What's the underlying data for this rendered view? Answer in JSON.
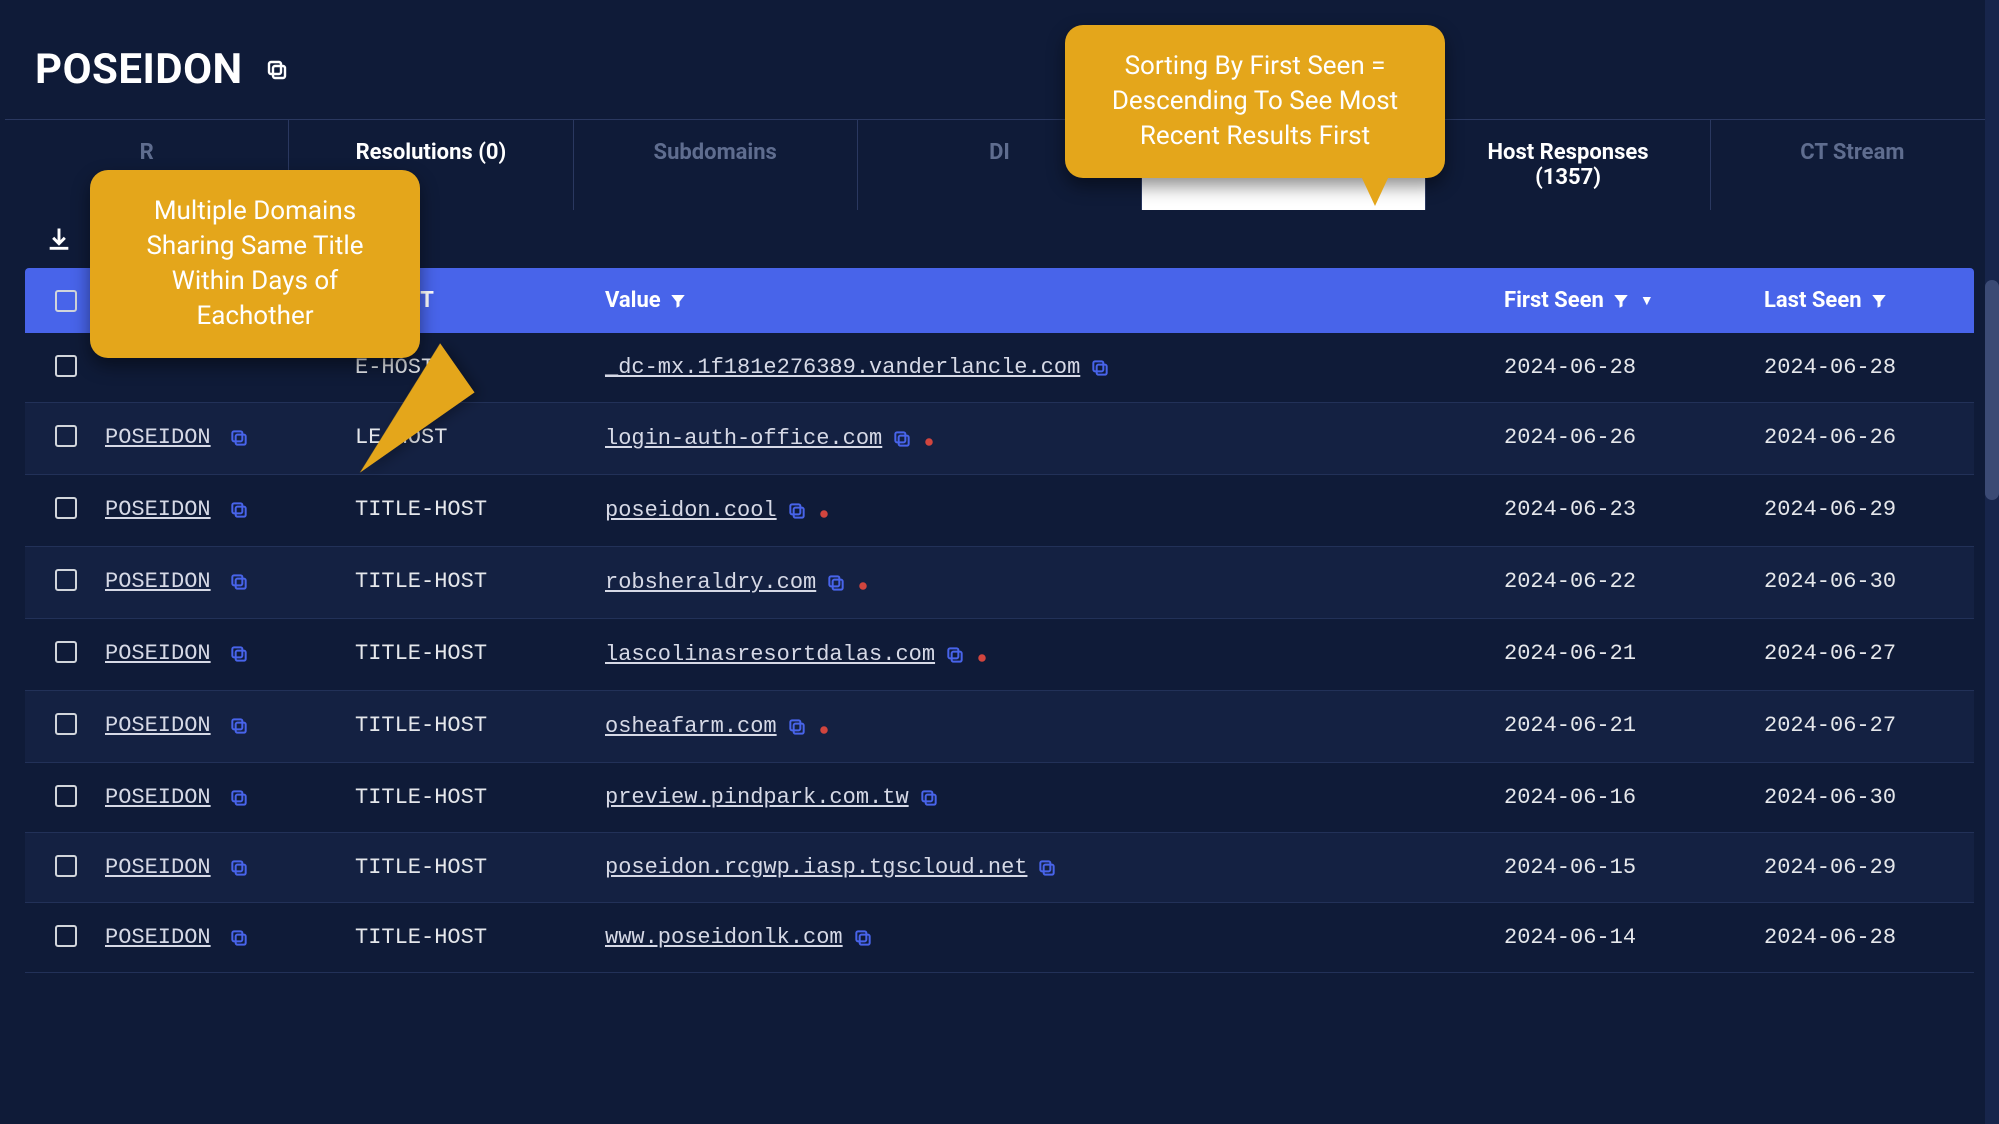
{
  "page_title": "POSEIDON",
  "tabs": [
    {
      "label": "R",
      "state": "normal"
    },
    {
      "label": "Resolutions (0)",
      "state": "highlight"
    },
    {
      "label": "Subdomains",
      "state": "normal"
    },
    {
      "label": "DI",
      "state": "normal"
    },
    {
      "label": "",
      "state": "active"
    },
    {
      "label": "Host Responses (1357)",
      "state": "highlight"
    },
    {
      "label": "CT Stream",
      "state": "normal"
    }
  ],
  "columns": {
    "title": "",
    "type_suffix": "E-HOST",
    "value": "Value",
    "first_seen": "First Seen",
    "last_seen": "Last Seen"
  },
  "callouts": {
    "sort": "Sorting By First Seen = Descending To See Most Recent Results First",
    "domains": "Multiple Domains Sharing Same Title Within Days of Eachother"
  },
  "rows": [
    {
      "title": "",
      "type": "E-HOST",
      "value": "_dc-mx.1f181e276389.vanderlancle.com",
      "warn": false,
      "first": "2024-06-28",
      "last": "2024-06-28"
    },
    {
      "title": "POSEIDON",
      "type": "LE-HOST",
      "value": "login-auth-office.com",
      "warn": true,
      "first": "2024-06-26",
      "last": "2024-06-26"
    },
    {
      "title": "POSEIDON",
      "type": "TITLE-HOST",
      "value": "poseidon.cool",
      "warn": true,
      "first": "2024-06-23",
      "last": "2024-06-29"
    },
    {
      "title": "POSEIDON",
      "type": "TITLE-HOST",
      "value": "robsheraldry.com",
      "warn": true,
      "first": "2024-06-22",
      "last": "2024-06-30"
    },
    {
      "title": "POSEIDON",
      "type": "TITLE-HOST",
      "value": "lascolinasresortdalas.com",
      "warn": true,
      "first": "2024-06-21",
      "last": "2024-06-27"
    },
    {
      "title": "POSEIDON",
      "type": "TITLE-HOST",
      "value": "osheafarm.com",
      "warn": true,
      "first": "2024-06-21",
      "last": "2024-06-27"
    },
    {
      "title": "POSEIDON",
      "type": "TITLE-HOST",
      "value": "preview.pindpark.com.tw",
      "warn": false,
      "first": "2024-06-16",
      "last": "2024-06-30"
    },
    {
      "title": "POSEIDON",
      "type": "TITLE-HOST",
      "value": "poseidon.rcgwp.iasp.tgscloud.net",
      "warn": false,
      "first": "2024-06-15",
      "last": "2024-06-29"
    },
    {
      "title": "POSEIDON",
      "type": "TITLE-HOST",
      "value": "www.poseidonlk.com",
      "warn": false,
      "first": "2024-06-14",
      "last": "2024-06-28"
    }
  ]
}
